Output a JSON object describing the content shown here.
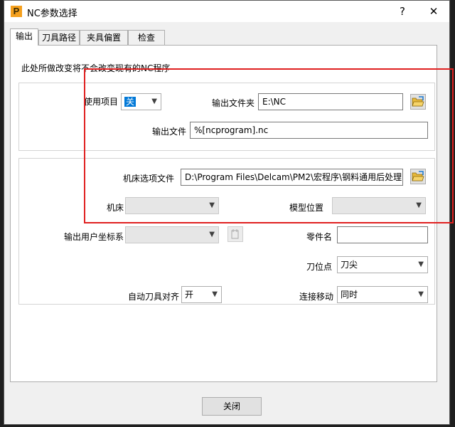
{
  "window": {
    "title": "NC参数选择",
    "app_icon_letter": "P",
    "help_symbol": "?",
    "close_symbol": "✕"
  },
  "tabs": [
    {
      "label": "输出",
      "active": true
    },
    {
      "label": "刀具路径",
      "active": false
    },
    {
      "label": "夹具偏置",
      "active": false
    },
    {
      "label": "检查",
      "active": false
    }
  ],
  "output": {
    "note": "此处所做改变将不会改变现有的NC程序",
    "use_item_label": "使用项目",
    "use_item_value": "关",
    "output_folder_label": "输出文件夹",
    "output_folder_value": "E:\\NC",
    "output_file_label": "输出文件",
    "output_file_value": "%[ncprogram].nc",
    "machine_option_file_label": "机床选项文件",
    "machine_option_file_value": "D:\\Program Files\\Delcam\\PM2\\宏程序\\钢料通用后处理",
    "machine_label": "机床",
    "machine_value": "",
    "model_position_label": "模型位置",
    "model_position_value": "",
    "output_user_cs_label": "输出用户坐标系",
    "output_user_cs_value": "",
    "part_name_label": "零件名",
    "part_name_value": "",
    "tool_point_label": "刀位点",
    "tool_point_value": "刀尖",
    "auto_tool_align_label": "自动刀具对齐",
    "auto_tool_align_value": "开",
    "connection_move_label": "连接移动",
    "connection_move_value": "同时"
  },
  "footer": {
    "close_label": "关闭"
  },
  "colors": {
    "highlight_box": "#e02020",
    "selection": "#0078d7",
    "app_icon": "#f5a01d"
  },
  "icons": [
    "folder-open-icon",
    "chevron-down-icon",
    "close-icon",
    "help-icon"
  ]
}
